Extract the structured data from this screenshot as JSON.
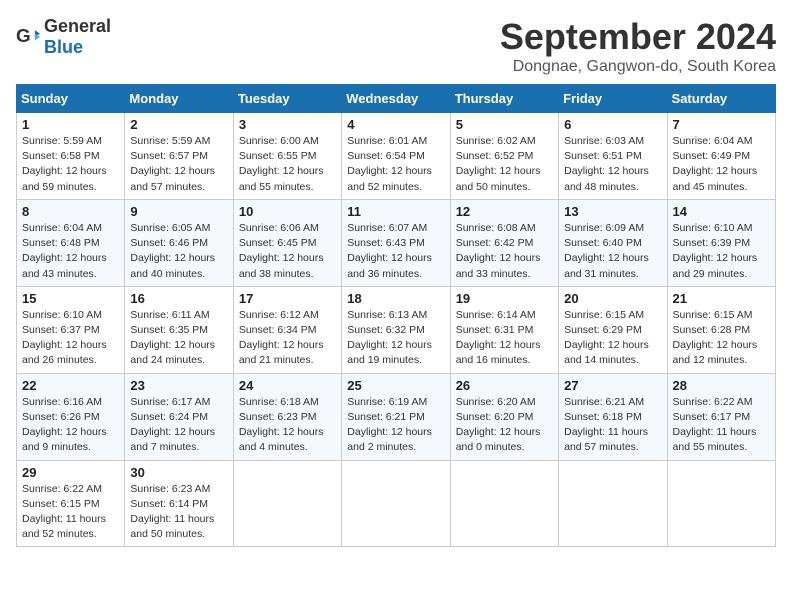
{
  "header": {
    "logo_general": "General",
    "logo_blue": "Blue",
    "title": "September 2024",
    "location": "Dongnae, Gangwon-do, South Korea"
  },
  "columns": [
    "Sunday",
    "Monday",
    "Tuesday",
    "Wednesday",
    "Thursday",
    "Friday",
    "Saturday"
  ],
  "weeks": [
    [
      {
        "day": "1",
        "info": "Sunrise: 5:59 AM\nSunset: 6:58 PM\nDaylight: 12 hours\nand 59 minutes."
      },
      {
        "day": "2",
        "info": "Sunrise: 5:59 AM\nSunset: 6:57 PM\nDaylight: 12 hours\nand 57 minutes."
      },
      {
        "day": "3",
        "info": "Sunrise: 6:00 AM\nSunset: 6:55 PM\nDaylight: 12 hours\nand 55 minutes."
      },
      {
        "day": "4",
        "info": "Sunrise: 6:01 AM\nSunset: 6:54 PM\nDaylight: 12 hours\nand 52 minutes."
      },
      {
        "day": "5",
        "info": "Sunrise: 6:02 AM\nSunset: 6:52 PM\nDaylight: 12 hours\nand 50 minutes."
      },
      {
        "day": "6",
        "info": "Sunrise: 6:03 AM\nSunset: 6:51 PM\nDaylight: 12 hours\nand 48 minutes."
      },
      {
        "day": "7",
        "info": "Sunrise: 6:04 AM\nSunset: 6:49 PM\nDaylight: 12 hours\nand 45 minutes."
      }
    ],
    [
      {
        "day": "8",
        "info": "Sunrise: 6:04 AM\nSunset: 6:48 PM\nDaylight: 12 hours\nand 43 minutes."
      },
      {
        "day": "9",
        "info": "Sunrise: 6:05 AM\nSunset: 6:46 PM\nDaylight: 12 hours\nand 40 minutes."
      },
      {
        "day": "10",
        "info": "Sunrise: 6:06 AM\nSunset: 6:45 PM\nDaylight: 12 hours\nand 38 minutes."
      },
      {
        "day": "11",
        "info": "Sunrise: 6:07 AM\nSunset: 6:43 PM\nDaylight: 12 hours\nand 36 minutes."
      },
      {
        "day": "12",
        "info": "Sunrise: 6:08 AM\nSunset: 6:42 PM\nDaylight: 12 hours\nand 33 minutes."
      },
      {
        "day": "13",
        "info": "Sunrise: 6:09 AM\nSunset: 6:40 PM\nDaylight: 12 hours\nand 31 minutes."
      },
      {
        "day": "14",
        "info": "Sunrise: 6:10 AM\nSunset: 6:39 PM\nDaylight: 12 hours\nand 29 minutes."
      }
    ],
    [
      {
        "day": "15",
        "info": "Sunrise: 6:10 AM\nSunset: 6:37 PM\nDaylight: 12 hours\nand 26 minutes."
      },
      {
        "day": "16",
        "info": "Sunrise: 6:11 AM\nSunset: 6:35 PM\nDaylight: 12 hours\nand 24 minutes."
      },
      {
        "day": "17",
        "info": "Sunrise: 6:12 AM\nSunset: 6:34 PM\nDaylight: 12 hours\nand 21 minutes."
      },
      {
        "day": "18",
        "info": "Sunrise: 6:13 AM\nSunset: 6:32 PM\nDaylight: 12 hours\nand 19 minutes."
      },
      {
        "day": "19",
        "info": "Sunrise: 6:14 AM\nSunset: 6:31 PM\nDaylight: 12 hours\nand 16 minutes."
      },
      {
        "day": "20",
        "info": "Sunrise: 6:15 AM\nSunset: 6:29 PM\nDaylight: 12 hours\nand 14 minutes."
      },
      {
        "day": "21",
        "info": "Sunrise: 6:15 AM\nSunset: 6:28 PM\nDaylight: 12 hours\nand 12 minutes."
      }
    ],
    [
      {
        "day": "22",
        "info": "Sunrise: 6:16 AM\nSunset: 6:26 PM\nDaylight: 12 hours\nand 9 minutes."
      },
      {
        "day": "23",
        "info": "Sunrise: 6:17 AM\nSunset: 6:24 PM\nDaylight: 12 hours\nand 7 minutes."
      },
      {
        "day": "24",
        "info": "Sunrise: 6:18 AM\nSunset: 6:23 PM\nDaylight: 12 hours\nand 4 minutes."
      },
      {
        "day": "25",
        "info": "Sunrise: 6:19 AM\nSunset: 6:21 PM\nDaylight: 12 hours\nand 2 minutes."
      },
      {
        "day": "26",
        "info": "Sunrise: 6:20 AM\nSunset: 6:20 PM\nDaylight: 12 hours\nand 0 minutes."
      },
      {
        "day": "27",
        "info": "Sunrise: 6:21 AM\nSunset: 6:18 PM\nDaylight: 11 hours\nand 57 minutes."
      },
      {
        "day": "28",
        "info": "Sunrise: 6:22 AM\nSunset: 6:17 PM\nDaylight: 11 hours\nand 55 minutes."
      }
    ],
    [
      {
        "day": "29",
        "info": "Sunrise: 6:22 AM\nSunset: 6:15 PM\nDaylight: 11 hours\nand 52 minutes."
      },
      {
        "day": "30",
        "info": "Sunrise: 6:23 AM\nSunset: 6:14 PM\nDaylight: 11 hours\nand 50 minutes."
      },
      {
        "day": "",
        "info": ""
      },
      {
        "day": "",
        "info": ""
      },
      {
        "day": "",
        "info": ""
      },
      {
        "day": "",
        "info": ""
      },
      {
        "day": "",
        "info": ""
      }
    ]
  ]
}
